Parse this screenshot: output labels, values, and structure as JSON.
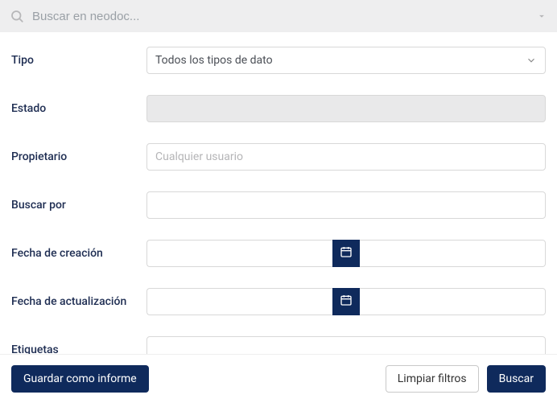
{
  "colors": {
    "accent": "#0f2a5c"
  },
  "search": {
    "placeholder": "Buscar en neodoc..."
  },
  "form": {
    "tipo": {
      "label": "Tipo",
      "value": "Todos los tipos de dato"
    },
    "estado": {
      "label": "Estado",
      "value": ""
    },
    "propietario": {
      "label": "Propietario",
      "placeholder": "Cualquier usuario",
      "value": ""
    },
    "buscar_por": {
      "label": "Buscar por",
      "value": ""
    },
    "fecha_creacion": {
      "label": "Fecha de creación",
      "from": "",
      "to": ""
    },
    "fecha_actualizacion": {
      "label": "Fecha de actualización",
      "from": "",
      "to": ""
    },
    "etiquetas": {
      "label": "Etiquetas",
      "value": ""
    }
  },
  "footer": {
    "guardar": "Guardar como informe",
    "limpiar": "Limpiar filtros",
    "buscar": "Buscar"
  }
}
